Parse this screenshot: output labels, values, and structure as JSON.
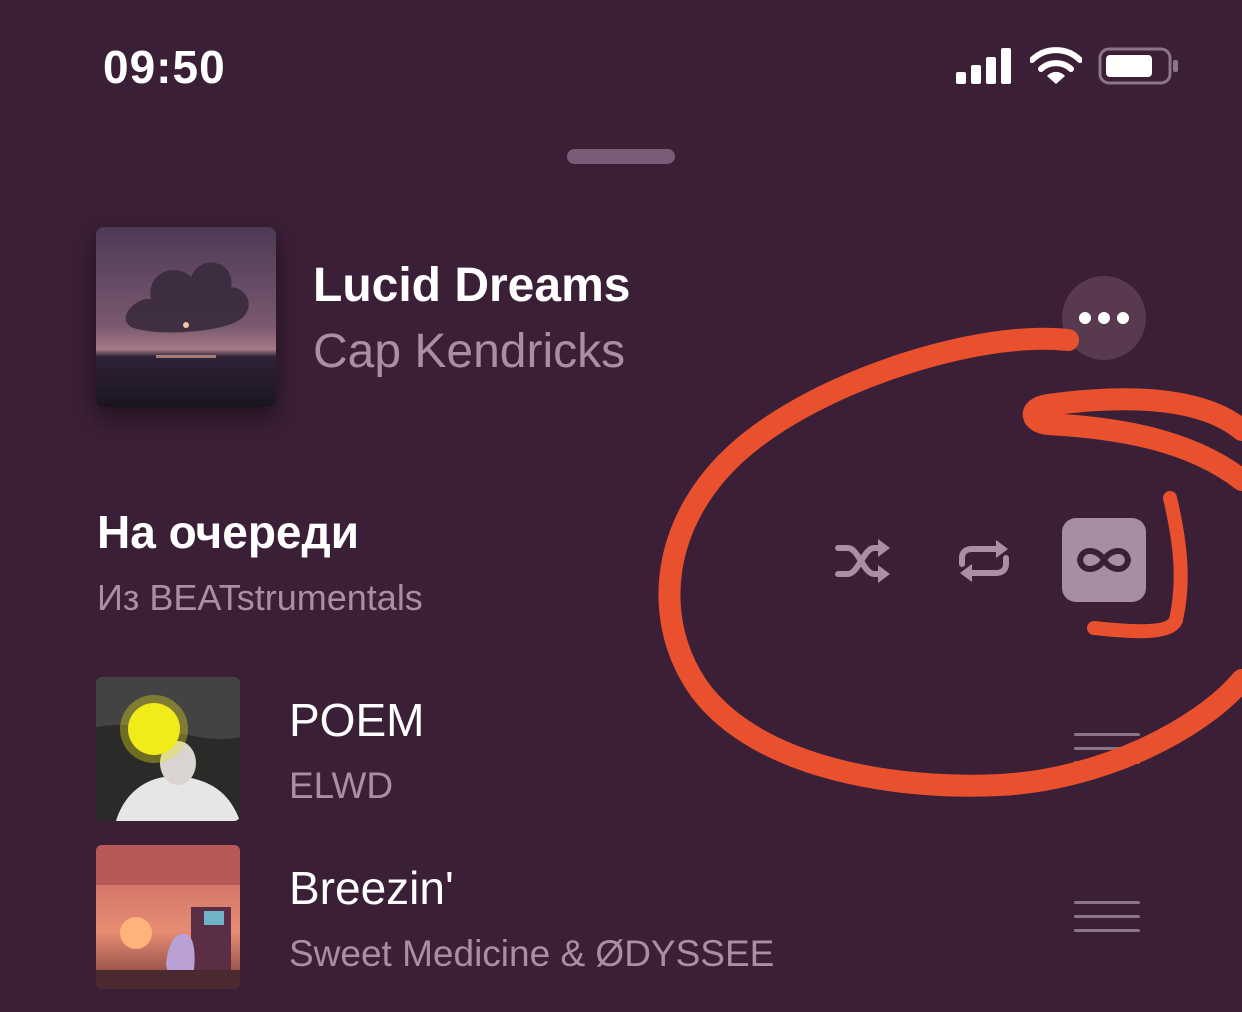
{
  "status_bar": {
    "time": "09:50",
    "signal_icon": "cellular-signal-icon",
    "wifi_icon": "wifi-icon",
    "battery_icon": "battery-icon"
  },
  "now_playing": {
    "title": "Lucid Dreams",
    "artist": "Cap Kendricks",
    "more_icon": "ellipsis-icon"
  },
  "queue": {
    "title": "На очереди",
    "source": "Из BEATstrumentals",
    "controls": {
      "shuffle_icon": "shuffle-icon",
      "repeat_icon": "repeat-icon",
      "infinite_icon": "infinity-icon",
      "infinite_active": true
    },
    "items": [
      {
        "title": "POEM",
        "artist": "ELWD"
      },
      {
        "title": "Breezin'",
        "artist": "Sweet Medicine & ØDYSSEE"
      }
    ]
  },
  "annotation": {
    "color": "#e8502e"
  },
  "colors": {
    "background": "#3b1f37",
    "secondary_text": "#a98ea6",
    "active_toggle": "#a88ea4"
  }
}
